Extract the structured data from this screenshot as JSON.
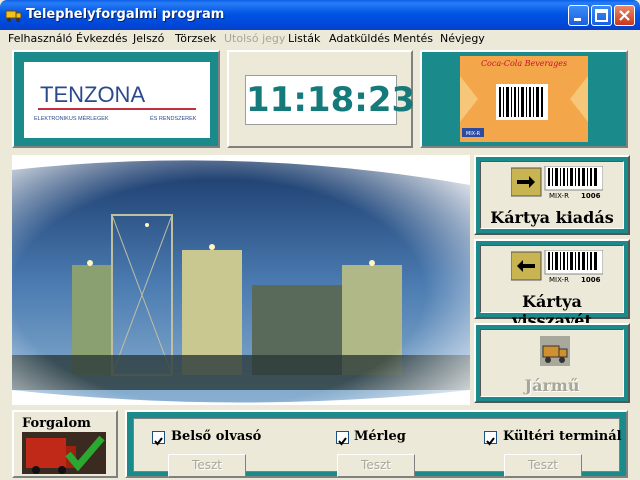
{
  "window": {
    "title": "Telephelyforgalmi program"
  },
  "menu": [
    {
      "label": "Felhasználó",
      "disabled": false
    },
    {
      "label": "Évkezdés",
      "disabled": false
    },
    {
      "label": "Jelszó",
      "disabled": false
    },
    {
      "label": "Törzsek",
      "disabled": false
    },
    {
      "label": "Utolsó jegy",
      "disabled": true
    },
    {
      "label": "Listák",
      "disabled": false
    },
    {
      "label": "Adatküldés",
      "disabled": false
    },
    {
      "label": "Mentés",
      "disabled": false
    },
    {
      "label": "Névjegy",
      "disabled": false
    }
  ],
  "logo": {
    "brand": "TENZONA",
    "tagline_left": "ELEKTRONIKUS MÉRLEGEK",
    "tagline_right": "ÉS RENDSZEREK"
  },
  "clock": {
    "time": "11:18:23"
  },
  "card_image": {
    "brand": "Coca-Cola Beverages",
    "code": "MIX-R"
  },
  "buttons": {
    "card_issue": {
      "label": "Kártya kiadás",
      "icon_text": "MIX-R",
      "icon_number": "1006"
    },
    "card_return": {
      "label": "Kártya visszavét",
      "icon_text": "MIX-R",
      "icon_number": "1006"
    },
    "vehicle": {
      "label": "Jármű"
    }
  },
  "forgalom": {
    "title": "Forgalom"
  },
  "status": {
    "items": [
      {
        "label": "Belső olvasó",
        "checked": true,
        "test_label": "Teszt"
      },
      {
        "label": "Mérleg",
        "checked": true,
        "test_label": "Teszt"
      },
      {
        "label": "Kültéri terminál",
        "checked": true,
        "test_label": "Teszt"
      }
    ]
  },
  "colors": {
    "accent": "#1a8a8a",
    "clock_text": "#167a7a",
    "titlebar": "#0055e5"
  }
}
